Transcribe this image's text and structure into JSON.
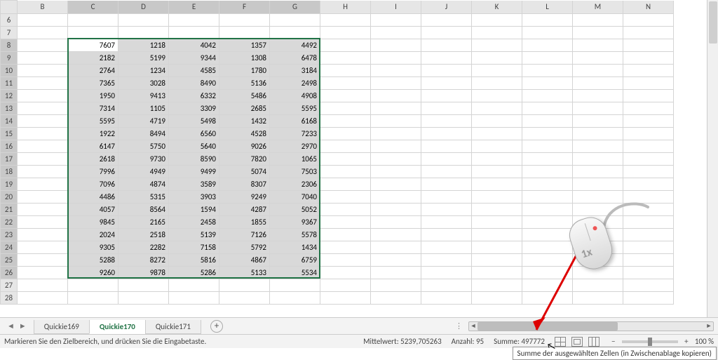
{
  "columns": [
    "B",
    "C",
    "D",
    "E",
    "F",
    "G",
    "H",
    "I",
    "J",
    "K",
    "L",
    "M",
    "N"
  ],
  "rows": [
    6,
    7,
    8,
    9,
    10,
    11,
    12,
    13,
    14,
    15,
    16,
    17,
    18,
    19,
    20,
    21,
    22,
    23,
    24,
    25,
    26,
    27,
    28
  ],
  "selection": {
    "firstRow": 8,
    "lastRow": 26,
    "firstCol": "C",
    "lastCol": "G"
  },
  "cells": {
    "8": {
      "C": 7607,
      "D": 1218,
      "E": 4042,
      "F": 1357,
      "G": 4492
    },
    "9": {
      "C": 2182,
      "D": 5199,
      "E": 9344,
      "F": 1308,
      "G": 6478
    },
    "10": {
      "C": 2764,
      "D": 1234,
      "E": 4585,
      "F": 1780,
      "G": 3184
    },
    "11": {
      "C": 7365,
      "D": 3028,
      "E": 8490,
      "F": 5136,
      "G": 2498
    },
    "12": {
      "C": 1950,
      "D": 9413,
      "E": 6332,
      "F": 5486,
      "G": 4908
    },
    "13": {
      "C": 7314,
      "D": 1105,
      "E": 3309,
      "F": 2685,
      "G": 5595
    },
    "14": {
      "C": 5595,
      "D": 4719,
      "E": 5498,
      "F": 1432,
      "G": 6168
    },
    "15": {
      "C": 1922,
      "D": 8494,
      "E": 6560,
      "F": 4528,
      "G": 7233
    },
    "16": {
      "C": 6147,
      "D": 5750,
      "E": 5640,
      "F": 9026,
      "G": 2970
    },
    "17": {
      "C": 2618,
      "D": 9730,
      "E": 8590,
      "F": 7820,
      "G": 1065
    },
    "18": {
      "C": 7996,
      "D": 4949,
      "E": 9499,
      "F": 5074,
      "G": 7503
    },
    "19": {
      "C": 7096,
      "D": 4874,
      "E": 3589,
      "F": 8307,
      "G": 2306
    },
    "20": {
      "C": 4486,
      "D": 5315,
      "E": 3903,
      "F": 9249,
      "G": 7040
    },
    "21": {
      "C": 4057,
      "D": 8564,
      "E": 1594,
      "F": 4287,
      "G": 5052
    },
    "22": {
      "C": 9845,
      "D": 2165,
      "E": 2458,
      "F": 1855,
      "G": 9367
    },
    "23": {
      "C": 2024,
      "D": 2518,
      "E": 5139,
      "F": 7126,
      "G": 5578
    },
    "24": {
      "C": 9305,
      "D": 2282,
      "E": 7158,
      "F": 5792,
      "G": 1434
    },
    "25": {
      "C": 5288,
      "D": 8272,
      "E": 5816,
      "F": 4867,
      "G": 6759
    },
    "26": {
      "C": 9260,
      "D": 9878,
      "E": 5286,
      "F": 5133,
      "G": 5534
    }
  },
  "tabs": {
    "items": [
      {
        "label": "Quickie169",
        "active": false
      },
      {
        "label": "Quickie170",
        "active": true
      },
      {
        "label": "Quickie171",
        "active": false
      }
    ]
  },
  "status": {
    "message": "Markieren Sie den Zielbereich, und drücken Sie die Eingabetaste.",
    "average_label": "Mittelwert:",
    "average_value": "5239,705263",
    "count_label": "Anzahl:",
    "count_value": "95",
    "sum_label": "Summe:",
    "sum_value": "497772",
    "zoom": "100 %"
  },
  "tooltip": "Summe der ausgewählten Zellen (in Zwischenablage kopieren)",
  "mouse_label": "1x"
}
